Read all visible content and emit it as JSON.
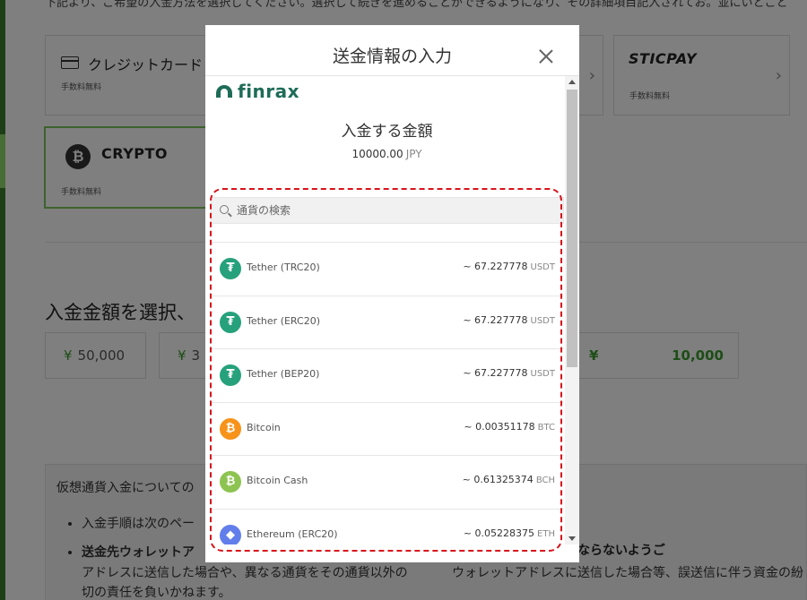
{
  "background": {
    "intro_text": "下記より、ご希望の入金方法を選択してください。選択して続きを進めることができるようになり、その詳細項目記入されてお。並にいとこと",
    "payment_methods": [
      {
        "title": "クレジットカード",
        "fee": "手数料無料",
        "icon": "credit-card-icon"
      },
      {
        "title": "STICPAY",
        "fee": "手数料無料"
      },
      {
        "title": "CRYPTO",
        "fee": "手数料無料",
        "icon": "bitcoin-icon"
      }
    ],
    "select_amount_title": "入金金額を選択、",
    "amounts": [
      {
        "yen": "¥",
        "value": "50,000"
      },
      {
        "yen": "¥",
        "value": "3"
      },
      {
        "yen": "¥",
        "value": "10,000"
      }
    ],
    "info": {
      "heading": "仮想通貨入金についての",
      "bullet1": "入金手順は次のペー",
      "bullet2": "送金先ウォレットア",
      "bullet2_right": "トアドレスをお使いにならないようご",
      "line3_right": "ウォレットアドレスに送信した場合等、誤送信に伴う資金の紛",
      "line3": "アドレスに送信した場合や、異なる通貨をその通貨以外の",
      "line4": "切の責任を負いかねます。"
    }
  },
  "modal": {
    "title": "送金情報の入力",
    "logo_text": "finrax",
    "deposit_label": "入金する金額",
    "deposit_amount": "10000.00",
    "deposit_currency": "JPY",
    "search_placeholder": "通貨の検索",
    "currencies": [
      {
        "name": "Tether (TRC20)",
        "value": "~ 67.227778",
        "unit": "USDT",
        "icon": "tether-icon",
        "color": "#26a17b",
        "glyph": "₮"
      },
      {
        "name": "Tether (ERC20)",
        "value": "~ 67.227778",
        "unit": "USDT",
        "icon": "tether-icon",
        "color": "#26a17b",
        "glyph": "₮"
      },
      {
        "name": "Tether (BEP20)",
        "value": "~ 67.227778",
        "unit": "USDT",
        "icon": "tether-icon",
        "color": "#26a17b",
        "glyph": "₮"
      },
      {
        "name": "Bitcoin",
        "value": "~ 0.00351178",
        "unit": "BTC",
        "icon": "bitcoin-icon",
        "color": "#f7931a",
        "glyph": "₿"
      },
      {
        "name": "Bitcoin Cash",
        "value": "~ 0.61325374",
        "unit": "BCH",
        "icon": "bitcoin-cash-icon",
        "color": "#8dc351",
        "glyph": "₿"
      },
      {
        "name": "Ethereum (ERC20)",
        "value": "~ 0.05228375",
        "unit": "ETH",
        "icon": "ethereum-icon",
        "color": "#627eea",
        "glyph": "◆"
      }
    ]
  },
  "colors": {
    "accent_green": "#3a9a2c",
    "finrax_green": "#1e6c58",
    "highlight_red": "#d8131b"
  }
}
